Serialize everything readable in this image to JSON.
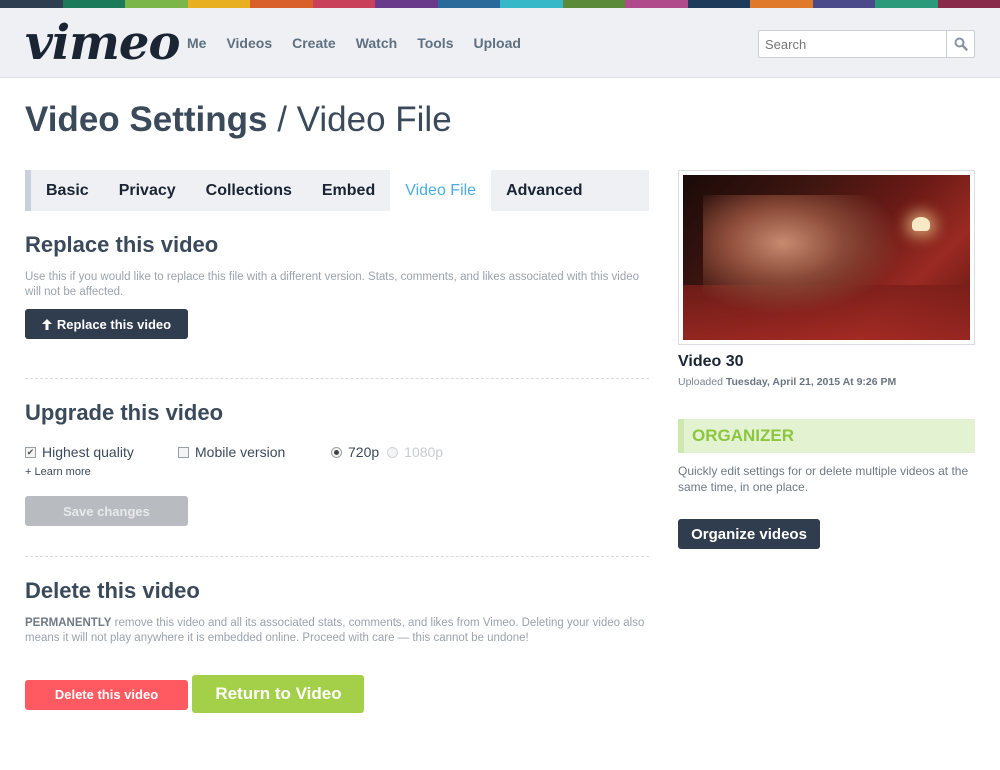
{
  "brand": {
    "logo": "vimeo",
    "stripe_colors": [
      "#2c3e50",
      "#1a7a5a",
      "#7ab648",
      "#e8b020",
      "#d9602a",
      "#c8405a",
      "#6a3a8a",
      "#2a6a9a",
      "#36b8c8",
      "#5a8a3a",
      "#b04a8a",
      "#1e3a5a",
      "#e07a2a",
      "#4a4a8a",
      "#2a9a7a",
      "#8a2a4a"
    ]
  },
  "nav": {
    "items": [
      "Me",
      "Videos",
      "Create",
      "Watch",
      "Tools",
      "Upload"
    ]
  },
  "search": {
    "placeholder": "Search",
    "icon": "search-icon"
  },
  "page": {
    "title_bold": "Video Settings",
    "title_separator": " / ",
    "title_light": "Video File"
  },
  "tabs": {
    "items": [
      "Basic",
      "Privacy",
      "Collections",
      "Embed",
      "Video File",
      "Advanced"
    ],
    "active": "Video File"
  },
  "replace": {
    "heading": "Replace this video",
    "description": "Use this if you would like to replace this file with a different version. Stats, comments, and likes associated with this video will not be affected.",
    "button": "Replace this video",
    "button_icon": "arrow-up-icon"
  },
  "upgrade": {
    "heading": "Upgrade this video",
    "highest_quality": {
      "label": "Highest quality",
      "checked": true
    },
    "mobile_version": {
      "label": "Mobile version",
      "checked": false
    },
    "resolution": {
      "options": [
        "720p",
        "1080p"
      ],
      "selected": "720p",
      "disabled": [
        "1080p"
      ]
    },
    "learn_more": "+ Learn more",
    "save_button": "Save changes"
  },
  "delete": {
    "heading": "Delete this video",
    "description_bold": "PERMANENTLY",
    "description": " remove this video and all its associated stats, comments, and likes from Vimeo. Deleting your video also means it will not play anywhere it is embedded online. Proceed with care — this cannot be undone!",
    "button": "Delete this video"
  },
  "return_button": "Return to Video",
  "video": {
    "title": "Video 30",
    "uploaded_label": "Uploaded ",
    "uploaded_date": "Tuesday, April 21, 2015 At 9:26 PM"
  },
  "organizer": {
    "heading": "ORGANIZER",
    "description": "Quickly edit settings for or delete multiple videos at the same time, in one place.",
    "button": "Organize videos"
  }
}
